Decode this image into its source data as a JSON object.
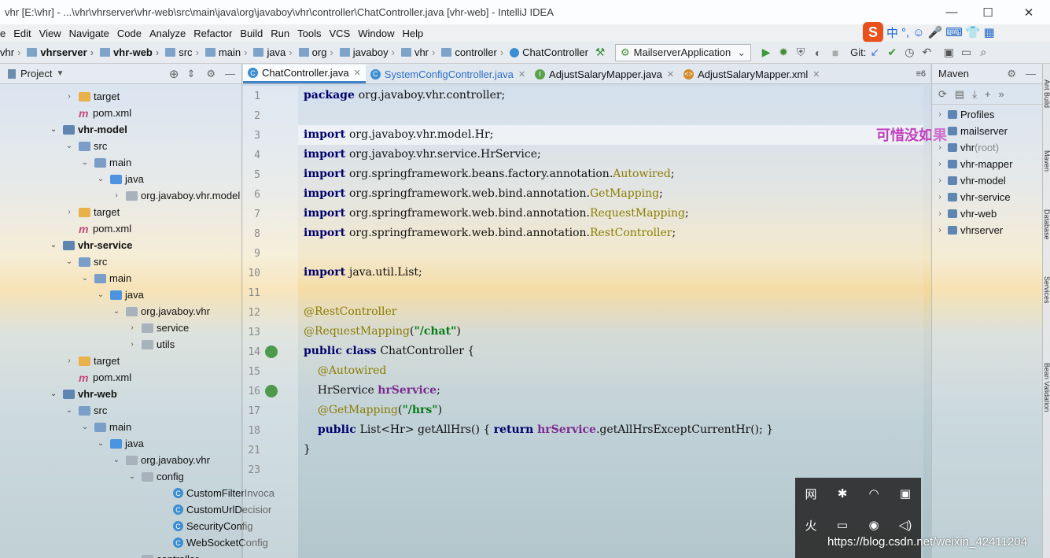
{
  "window": {
    "title": "vhr [E:\\vhr] - ...\\vhr\\vhrserver\\vhr-web\\src\\main\\java\\org\\javaboy\\vhr\\controller\\ChatController.java [vhr-web] - IntelliJ IDEA",
    "minimize": "—",
    "maximize": "☐",
    "close": "✕"
  },
  "menu": [
    "e",
    "Edit",
    "View",
    "Navigate",
    "Code",
    "Analyze",
    "Refactor",
    "Build",
    "Run",
    "Tools",
    "VCS",
    "Window",
    "Help"
  ],
  "ime": {
    "logo": "S",
    "items": [
      "中",
      "°,",
      "☺",
      "🎤",
      "⌨",
      "👕",
      "▦"
    ]
  },
  "breadcrumbs": [
    "vhr",
    "vhrserver",
    "vhr-web",
    "src",
    "main",
    "java",
    "org",
    "javaboy",
    "vhr",
    "controller",
    "ChatController"
  ],
  "run_config": "MailserverApplication",
  "git_label": "Git:",
  "project_panel": {
    "title": "Project"
  },
  "project_tree": [
    {
      "label": "target",
      "depth": 3,
      "arrow": "›",
      "icon": "folder"
    },
    {
      "label": "pom.xml",
      "depth": 3,
      "arrow": "",
      "icon": "mvn"
    },
    {
      "label": "vhr-model",
      "depth": 2,
      "arrow": "⌄",
      "icon": "module",
      "bold": true
    },
    {
      "label": "src",
      "depth": 3,
      "arrow": "⌄",
      "icon": "srcf"
    },
    {
      "label": "main",
      "depth": 4,
      "arrow": "⌄",
      "icon": "srcf"
    },
    {
      "label": "java",
      "depth": 5,
      "arrow": "⌄",
      "icon": "src-java"
    },
    {
      "label": "org.javaboy.vhr.model",
      "depth": 6,
      "arrow": "›",
      "icon": "pkg"
    },
    {
      "label": "target",
      "depth": 3,
      "arrow": "›",
      "icon": "folder"
    },
    {
      "label": "pom.xml",
      "depth": 3,
      "arrow": "",
      "icon": "mvn"
    },
    {
      "label": "vhr-service",
      "depth": 2,
      "arrow": "⌄",
      "icon": "module",
      "bold": true
    },
    {
      "label": "src",
      "depth": 3,
      "arrow": "⌄",
      "icon": "srcf"
    },
    {
      "label": "main",
      "depth": 4,
      "arrow": "⌄",
      "icon": "srcf"
    },
    {
      "label": "java",
      "depth": 5,
      "arrow": "⌄",
      "icon": "src-java"
    },
    {
      "label": "org.javaboy.vhr",
      "depth": 6,
      "arrow": "⌄",
      "icon": "pkg"
    },
    {
      "label": "service",
      "depth": 7,
      "arrow": "›",
      "icon": "pkg"
    },
    {
      "label": "utils",
      "depth": 7,
      "arrow": "›",
      "icon": "pkg"
    },
    {
      "label": "target",
      "depth": 3,
      "arrow": "›",
      "icon": "folder"
    },
    {
      "label": "pom.xml",
      "depth": 3,
      "arrow": "",
      "icon": "mvn"
    },
    {
      "label": "vhr-web",
      "depth": 2,
      "arrow": "⌄",
      "icon": "module",
      "bold": true
    },
    {
      "label": "src",
      "depth": 3,
      "arrow": "⌄",
      "icon": "srcf"
    },
    {
      "label": "main",
      "depth": 4,
      "arrow": "⌄",
      "icon": "srcf"
    },
    {
      "label": "java",
      "depth": 5,
      "arrow": "⌄",
      "icon": "src-java"
    },
    {
      "label": "org.javaboy.vhr",
      "depth": 6,
      "arrow": "⌄",
      "icon": "pkg"
    },
    {
      "label": "config",
      "depth": 7,
      "arrow": "⌄",
      "icon": "pkg"
    },
    {
      "label": "CustomFilterInvoca",
      "depth": 9,
      "arrow": "",
      "icon": "cls"
    },
    {
      "label": "CustomUrlDecisior",
      "depth": 9,
      "arrow": "",
      "icon": "cls"
    },
    {
      "label": "SecurityConfig",
      "depth": 9,
      "arrow": "",
      "icon": "cls"
    },
    {
      "label": "WebSocketConfig",
      "depth": 9,
      "arrow": "",
      "icon": "cls"
    },
    {
      "label": "controller",
      "depth": 7,
      "arrow": "⌄",
      "icon": "pkg"
    }
  ],
  "tabs": [
    {
      "label": "ChatController.java",
      "icon": "C",
      "color": "#3c8ed2",
      "active": true,
      "label_color": "#111111"
    },
    {
      "label": "SystemConfigController.java",
      "icon": "C",
      "color": "#3c8ed2",
      "active": false,
      "label_color": "#2f6fc6"
    },
    {
      "label": "AdjustSalaryMapper.java",
      "icon": "I",
      "color": "#5aa34a",
      "active": false,
      "label_color": "#111111"
    },
    {
      "label": "AdjustSalaryMapper.xml",
      "icon": "<>",
      "color": "#d38b2c",
      "active": false,
      "label_color": "#111111"
    }
  ],
  "tab_overflow": "≡6",
  "code_lines": [
    {
      "n": "1",
      "segs": [
        [
          "kw",
          "package "
        ],
        [
          "",
          "org.javaboy.vhr.controller;"
        ]
      ]
    },
    {
      "n": "2",
      "segs": []
    },
    {
      "n": "3",
      "segs": [
        [
          "kw",
          "import "
        ],
        [
          "",
          "org.javaboy.vhr.model.Hr;"
        ]
      ]
    },
    {
      "n": "4",
      "segs": [
        [
          "kw",
          "import "
        ],
        [
          "",
          "org.javaboy.vhr.service.HrService;"
        ]
      ]
    },
    {
      "n": "5",
      "segs": [
        [
          "kw",
          "import "
        ],
        [
          "",
          "org.springframework.beans.factory.annotation."
        ],
        [
          "ann",
          "Autowired"
        ],
        [
          "",
          ";"
        ]
      ]
    },
    {
      "n": "6",
      "segs": [
        [
          "kw",
          "import "
        ],
        [
          "",
          "org.springframework.web.bind.annotation."
        ],
        [
          "ann",
          "GetMapping"
        ],
        [
          "",
          ";"
        ]
      ]
    },
    {
      "n": "7",
      "segs": [
        [
          "kw",
          "import "
        ],
        [
          "",
          "org.springframework.web.bind.annotation."
        ],
        [
          "ann",
          "RequestMapping"
        ],
        [
          "",
          ";"
        ]
      ]
    },
    {
      "n": "8",
      "segs": [
        [
          "kw",
          "import "
        ],
        [
          "",
          "org.springframework.web.bind.annotation."
        ],
        [
          "ann",
          "RestController"
        ],
        [
          "",
          ";"
        ]
      ]
    },
    {
      "n": "9",
      "segs": []
    },
    {
      "n": "10",
      "segs": [
        [
          "kw",
          "import "
        ],
        [
          "",
          "java.util.List;"
        ]
      ]
    },
    {
      "n": "11",
      "segs": []
    },
    {
      "n": "12",
      "segs": [
        [
          "ann",
          "@RestController"
        ]
      ]
    },
    {
      "n": "13",
      "segs": [
        [
          "ann",
          "@RequestMapping"
        ],
        [
          "",
          "("
        ],
        [
          "str",
          "\"/chat\""
        ],
        [
          "",
          ")"
        ]
      ]
    },
    {
      "n": "14",
      "segs": [
        [
          "kw",
          "public class "
        ],
        [
          "",
          "ChatController {"
        ]
      ]
    },
    {
      "n": "15",
      "segs": [
        [
          "",
          "    "
        ],
        [
          "ann",
          "@Autowired"
        ]
      ]
    },
    {
      "n": "16",
      "segs": [
        [
          "",
          "    HrService "
        ],
        [
          "fld",
          "hrService"
        ],
        [
          "",
          ";"
        ]
      ]
    },
    {
      "n": "17",
      "segs": [
        [
          "",
          "    "
        ],
        [
          "ann",
          "@GetMapping"
        ],
        [
          "",
          "("
        ],
        [
          "str",
          "\"/hrs\""
        ],
        [
          "",
          ")"
        ]
      ]
    },
    {
      "n": "18",
      "segs": [
        [
          "",
          "    "
        ],
        [
          "kw",
          "public "
        ],
        [
          "",
          "List<Hr> getAllHrs() { "
        ],
        [
          "kw",
          "return "
        ],
        [
          "fld",
          "hrService"
        ],
        [
          "",
          ".getAllHrsExceptCurrentHr(); }"
        ]
      ]
    },
    {
      "n": "21",
      "segs": [
        [
          "",
          "}"
        ]
      ]
    },
    {
      "n": "23",
      "segs": []
    }
  ],
  "watermark": "可惜没如果",
  "maven_panel": {
    "title": "Maven",
    "items": [
      {
        "label": "Profiles",
        "arrow": "›"
      },
      {
        "label": "mailserver",
        "arrow": ""
      },
      {
        "label": "vhr",
        "suffix": " (root)",
        "arrow": "›"
      },
      {
        "label": "vhr-mapper",
        "arrow": "›"
      },
      {
        "label": "vhr-model",
        "arrow": "›"
      },
      {
        "label": "vhr-service",
        "arrow": "›"
      },
      {
        "label": "vhr-web",
        "arrow": "›"
      },
      {
        "label": "vhrserver",
        "arrow": "›"
      }
    ]
  },
  "right_side_tabs": [
    "Ant Build",
    "Maven",
    "Database",
    "Services",
    "Bean Validation"
  ],
  "tray_icons": [
    "网",
    "✱",
    "◠",
    "▣",
    "火",
    "▭",
    "◉",
    "◁)",
    "",
    "",
    "",
    ""
  ],
  "csdn_watermark": "https://blog.csdn.net/weixin_42411204"
}
